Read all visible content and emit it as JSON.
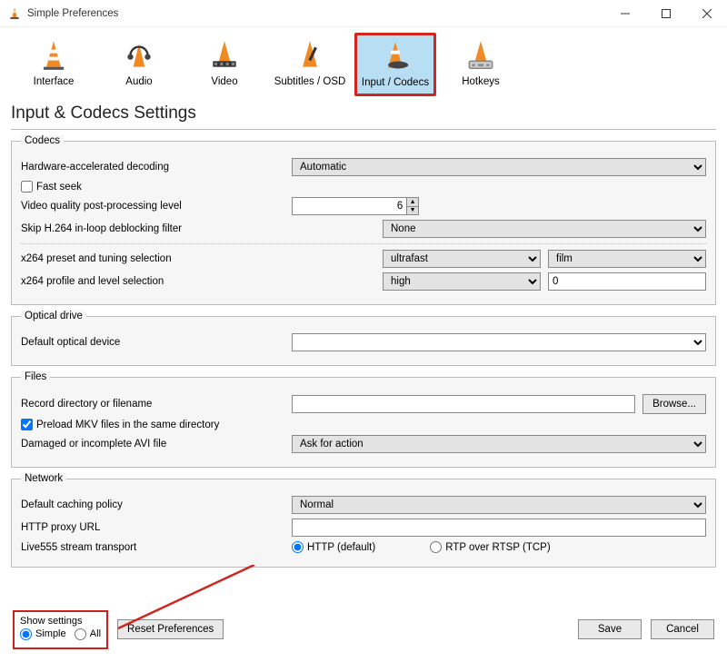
{
  "window": {
    "title": "Simple Preferences"
  },
  "toolbar": [
    {
      "key": "interface",
      "label": "Interface"
    },
    {
      "key": "audio",
      "label": "Audio"
    },
    {
      "key": "video",
      "label": "Video"
    },
    {
      "key": "subtitles",
      "label": "Subtitles / OSD"
    },
    {
      "key": "input-codecs",
      "label": "Input / Codecs"
    },
    {
      "key": "hotkeys",
      "label": "Hotkeys"
    }
  ],
  "page_title": "Input & Codecs Settings",
  "codecs": {
    "legend": "Codecs",
    "hw_decode": {
      "label": "Hardware-accelerated decoding",
      "value": "Automatic"
    },
    "fast_seek": {
      "label": "Fast seek",
      "checked": false
    },
    "vq_post": {
      "label": "Video quality post-processing level",
      "value": "6"
    },
    "skip_deblock": {
      "label": "Skip H.264 in-loop deblocking filter",
      "value": "None"
    },
    "x264_preset": {
      "label": "x264 preset and tuning selection",
      "preset": "ultrafast",
      "tuning": "film"
    },
    "x264_profile": {
      "label": "x264 profile and level selection",
      "profile": "high",
      "level": "0"
    }
  },
  "optical": {
    "legend": "Optical drive",
    "default_device": {
      "label": "Default optical device",
      "value": ""
    }
  },
  "files": {
    "legend": "Files",
    "record_dir": {
      "label": "Record directory or filename",
      "value": "",
      "browse": "Browse..."
    },
    "preload_mkv": {
      "label": "Preload MKV files in the same directory",
      "checked": true
    },
    "damaged_avi": {
      "label": "Damaged or incomplete AVI file",
      "value": "Ask for action"
    }
  },
  "network": {
    "legend": "Network",
    "caching": {
      "label": "Default caching policy",
      "value": "Normal"
    },
    "proxy": {
      "label": "HTTP proxy URL",
      "value": ""
    },
    "live555": {
      "label": "Live555 stream transport",
      "http": "HTTP (default)",
      "rtp": "RTP over RTSP (TCP)",
      "selected": "http"
    }
  },
  "footer": {
    "show_settings": {
      "title": "Show settings",
      "simple": "Simple",
      "all": "All",
      "selected": "simple"
    },
    "reset": "Reset Preferences",
    "save": "Save",
    "cancel": "Cancel"
  }
}
